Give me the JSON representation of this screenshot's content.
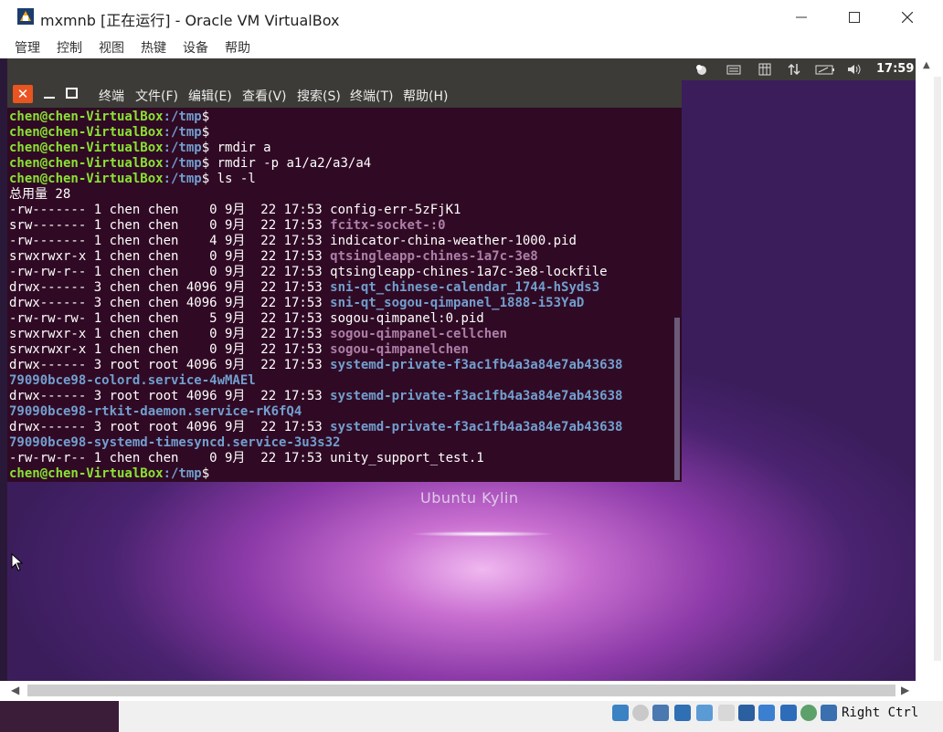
{
  "window": {
    "title": "mxmnb [正在运行] - Oracle VM VirtualBox",
    "controls": {
      "minimize": "─",
      "maximize": "☐",
      "close": "✕"
    }
  },
  "menubar": [
    "管理",
    "控制",
    "视图",
    "热键",
    "设备",
    "帮助"
  ],
  "guest_panel": {
    "clock": "17:59"
  },
  "terminal": {
    "menus": [
      "终端",
      "文件(F)",
      "编辑(E)",
      "查看(V)",
      "搜索(S)",
      "终端(T)",
      "帮助(H)"
    ],
    "prompt_user": "chen@chen-VirtualBox",
    "prompt_path": ":/tmp",
    "prompt_symbol": "$",
    "lines": [
      {
        "kind": "prompt",
        "cmd": ""
      },
      {
        "kind": "prompt",
        "cmd": ""
      },
      {
        "kind": "prompt",
        "cmd": " rmdir a"
      },
      {
        "kind": "prompt",
        "cmd": " rmdir -p a1/a2/a3/a4"
      },
      {
        "kind": "prompt",
        "cmd": " ls -l"
      },
      {
        "kind": "text",
        "text": "总用量 28"
      },
      {
        "kind": "entry",
        "meta": "-rw------- 1 chen chen    0 9月  22 17:53 ",
        "name": "config-err-5zFjK1",
        "style": "plain"
      },
      {
        "kind": "entry",
        "meta": "srw------- 1 chen chen    0 9月  22 17:53 ",
        "name": "fcitx-socket-:0",
        "style": "sock"
      },
      {
        "kind": "entry",
        "meta": "-rw------- 1 chen chen    4 9月  22 17:53 ",
        "name": "indicator-china-weather-1000.pid",
        "style": "plain"
      },
      {
        "kind": "entry",
        "meta": "srwxrwxr-x 1 chen chen    0 9月  22 17:53 ",
        "name": "qtsingleapp-chines-1a7c-3e8",
        "style": "sock"
      },
      {
        "kind": "entry",
        "meta": "-rw-rw-r-- 1 chen chen    0 9月  22 17:53 ",
        "name": "qtsingleapp-chines-1a7c-3e8-lockfile",
        "style": "plain"
      },
      {
        "kind": "entry",
        "meta": "drwx------ 3 chen chen 4096 9月  22 17:53 ",
        "name": "sni-qt_chinese-calendar_1744-hSyds3",
        "style": "dir"
      },
      {
        "kind": "entry",
        "meta": "drwx------ 3 chen chen 4096 9月  22 17:53 ",
        "name": "sni-qt_sogou-qimpanel_1888-i53YaD",
        "style": "dir"
      },
      {
        "kind": "entry",
        "meta": "-rw-rw-rw- 1 chen chen    5 9月  22 17:53 ",
        "name": "sogou-qimpanel:0.pid",
        "style": "plain"
      },
      {
        "kind": "entry",
        "meta": "srwxrwxr-x 1 chen chen    0 9月  22 17:53 ",
        "name": "sogou-qimpanel-cellchen",
        "style": "sock"
      },
      {
        "kind": "entry",
        "meta": "srwxrwxr-x 1 chen chen    0 9月  22 17:53 ",
        "name": "sogou-qimpanelchen",
        "style": "sock"
      },
      {
        "kind": "entry",
        "meta": "drwx------ 3 root root 4096 9月  22 17:53 ",
        "name": "systemd-private-f3ac1fb4a3a84e7ab43638",
        "style": "dir"
      },
      {
        "kind": "entry",
        "meta": "",
        "name": "79090bce98-colord.service-4wMAEl",
        "style": "dir"
      },
      {
        "kind": "entry",
        "meta": "drwx------ 3 root root 4096 9月  22 17:53 ",
        "name": "systemd-private-f3ac1fb4a3a84e7ab43638",
        "style": "dir"
      },
      {
        "kind": "entry",
        "meta": "",
        "name": "79090bce98-rtkit-daemon.service-rK6fQ4",
        "style": "dir"
      },
      {
        "kind": "entry",
        "meta": "drwx------ 3 root root 4096 9月  22 17:53 ",
        "name": "systemd-private-f3ac1fb4a3a84e7ab43638",
        "style": "dir"
      },
      {
        "kind": "entry",
        "meta": "",
        "name": "79090bce98-systemd-timesyncd.service-3u3s32",
        "style": "dir"
      },
      {
        "kind": "entry",
        "meta": "-rw-rw-r-- 1 chen chen    0 9月  22 17:53 ",
        "name": "unity_support_test.1",
        "style": "plain"
      },
      {
        "kind": "prompt",
        "cmd": " "
      }
    ]
  },
  "desktop": {
    "label": "Ubuntu Kylin"
  },
  "statusbar": {
    "host_key": "Right Ctrl"
  },
  "colors": {
    "terminal_bg": "#300a24",
    "prompt_user": "#8ae234",
    "directory": "#729fcf",
    "socket": "#ad7fa8",
    "close_button": "#e95420"
  }
}
